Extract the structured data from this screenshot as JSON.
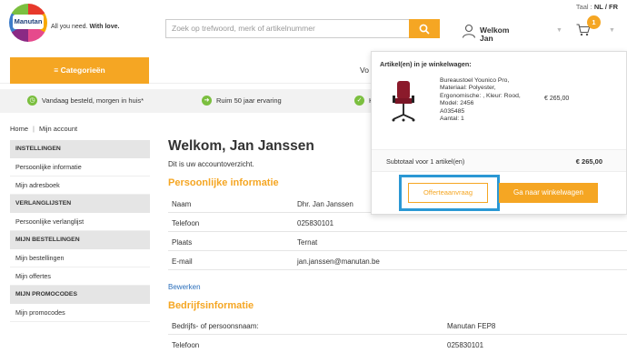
{
  "header": {
    "logo_text": "Manutan",
    "tagline_prefix": "All you need.",
    "tagline_bold": "With love.",
    "language_label": "Taal :",
    "language_options": "NL / FR",
    "search_placeholder": "Zoek op trefwoord, merk of artikelnummer",
    "user_line1": "Welkom",
    "user_line2": "Jan",
    "cart_count": "1"
  },
  "nav": {
    "categories_label": "≡ Categorieën",
    "partial_item": "Vo"
  },
  "usp": [
    {
      "label": "Vandaag besteld, morgen in huis*"
    },
    {
      "label": "Ruim 50 jaar ervaring"
    },
    {
      "label": "K"
    }
  ],
  "breadcrumb": [
    "Home",
    "Mijn account"
  ],
  "sidebar": {
    "sections": [
      {
        "title": "INSTELLINGEN",
        "items": [
          "Persoonlijke informatie",
          "Mijn adresboek"
        ]
      },
      {
        "title": "VERLANGLIJSTEN",
        "items": [
          "Persoonlijke verlanglijst"
        ]
      },
      {
        "title": "MIJN BESTELLINGEN",
        "items": [
          "Mijn bestellingen",
          "Mijn offertes"
        ]
      },
      {
        "title": "MIJN PROMOCODES",
        "items": [
          "Mijn promocodes"
        ]
      }
    ]
  },
  "main": {
    "title": "Welkom, Jan Janssen",
    "subtitle": "Dit is uw accountoverzicht.",
    "personal_title": "Persoonlijke informatie",
    "personal": [
      {
        "k": "Naam",
        "v": "Dhr. Jan Janssen"
      },
      {
        "k": "Telefoon",
        "v": "025830101"
      },
      {
        "k": "Plaats",
        "v": "Ternat"
      },
      {
        "k": "E-mail",
        "v": "jan.janssen@manutan.be"
      }
    ],
    "edit_link": "Bewerken",
    "company_title": "Bedrijfsinformatie",
    "company": [
      {
        "k": "Bedrijfs- of persoonsnaam:",
        "v": "Manutan FEP8"
      },
      {
        "k": "Telefoon",
        "v": "025830101"
      }
    ]
  },
  "cart_popup": {
    "title": "Artikel(en) in je winkelwagen:",
    "product_lines": [
      "Bureaustoel Younico Pro,",
      "Materiaal: Polyester,",
      "Ergonomische: , Kleur: Rood,",
      "Model: 2456",
      "A035485",
      "Aantal: 1"
    ],
    "product_price": "€ 265,00",
    "subtotal_label": "Subtotaal voor 1 artikel(en)",
    "subtotal_value": "€ 265,00",
    "quote_button": "Offerteaanvraag",
    "cart_button": "Ga naar winkelwagen"
  },
  "colors": {
    "accent": "#f5a623",
    "highlight": "#2b98d4",
    "link": "#2a6ebb",
    "usp_icon": "#7bbf3f"
  }
}
